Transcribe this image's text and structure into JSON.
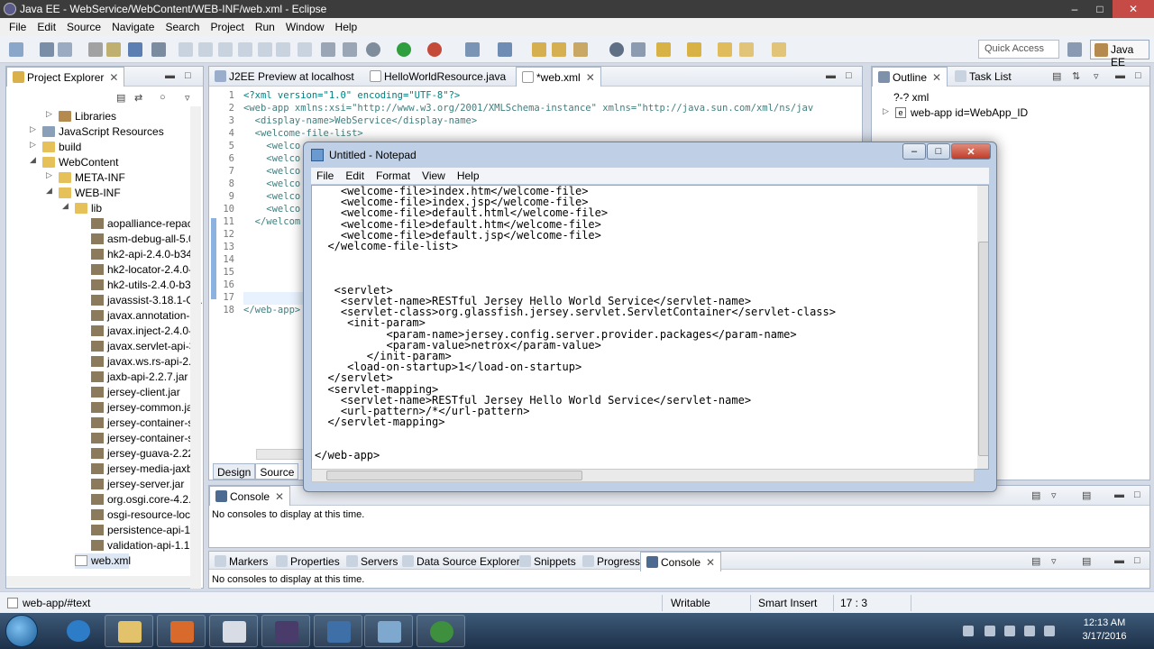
{
  "window": {
    "title": "Java EE - WebService/WebContent/WEB-INF/web.xml - Eclipse"
  },
  "menubar": [
    "File",
    "Edit",
    "Source",
    "Navigate",
    "Search",
    "Project",
    "Run",
    "Window",
    "Help"
  ],
  "toolbar": {
    "quick_access": "Quick Access",
    "perspective": "Java EE"
  },
  "explorer": {
    "title": "Project Explorer",
    "items": [
      "Libraries",
      "JavaScript Resources",
      "build",
      "WebContent",
      "META-INF",
      "WEB-INF",
      "lib",
      "aopalliance-repac",
      "asm-debug-all-5.0",
      "hk2-api-2.4.0-b34.",
      "hk2-locator-2.4.0-",
      "hk2-utils-2.4.0-b34",
      "javassist-3.18.1-GA",
      "javax.annotation-a",
      "javax.inject-2.4.0-",
      "javax.servlet-api-3",
      "javax.ws.rs-api-2.0",
      "jaxb-api-2.2.7.jar",
      "jersey-client.jar",
      "jersey-common.ja",
      "jersey-container-s",
      "jersey-container-s",
      "jersey-guava-2.22.",
      "jersey-media-jaxb",
      "jersey-server.jar",
      "org.osgi.core-4.2.0",
      "osgi-resource-loca",
      "persistence-api-1.0",
      "validation-api-1.1.",
      "web.xml"
    ]
  },
  "editor": {
    "tabs": [
      "J2EE Preview at localhost",
      "HelloWorldResource.java",
      "*web.xml"
    ],
    "lines": [
      {
        "n": "1",
        "text": "<?xml version=\"1.0\" encoding=\"UTF-8\"?>"
      },
      {
        "n": "2",
        "text": "<web-app xmlns:xsi=\"http://www.w3.org/2001/XMLSchema-instance\" xmlns=\"http://java.sun.com/xml/ns/jav"
      },
      {
        "n": "3",
        "text": "  <display-name>WebService</display-name>"
      },
      {
        "n": "4",
        "text": "  <welcome-file-list>"
      },
      {
        "n": "5",
        "text": "    <welco"
      },
      {
        "n": "6",
        "text": "    <welco"
      },
      {
        "n": "7",
        "text": "    <welco"
      },
      {
        "n": "8",
        "text": "    <welco"
      },
      {
        "n": "9",
        "text": "    <welco"
      },
      {
        "n": "10",
        "text": "    <welco"
      },
      {
        "n": "11",
        "text": "  </welcom"
      },
      {
        "n": "12",
        "text": ""
      },
      {
        "n": "13",
        "text": ""
      },
      {
        "n": "14",
        "text": ""
      },
      {
        "n": "15",
        "text": ""
      },
      {
        "n": "16",
        "text": ""
      },
      {
        "n": "17",
        "text": ""
      },
      {
        "n": "18",
        "text": "</web-app>"
      }
    ],
    "bottom_tabs": [
      "Design",
      "Source"
    ]
  },
  "outline": {
    "tabs": [
      "Outline",
      "Task List"
    ],
    "items": [
      "?-? xml",
      "web-app id=WebApp_ID"
    ]
  },
  "console_top": {
    "tab": "Console",
    "message": "No consoles to display at this time."
  },
  "console_bottom": {
    "tabs": [
      "Markers",
      "Properties",
      "Servers",
      "Data Source Explorer",
      "Snippets",
      "Progress",
      "Console"
    ],
    "message": "No consoles to display at this time."
  },
  "statusbar": {
    "path": "web-app/#text",
    "writable": "Writable",
    "insert_mode": "Smart Insert",
    "position": "17 : 3"
  },
  "notepad": {
    "title": "Untitled - Notepad",
    "menu": [
      "File",
      "Edit",
      "Format",
      "View",
      "Help"
    ],
    "content": "    <welcome-file>index.htm</welcome-file>\n    <welcome-file>index.jsp</welcome-file>\n    <welcome-file>default.html</welcome-file>\n    <welcome-file>default.htm</welcome-file>\n    <welcome-file>default.jsp</welcome-file>\n  </welcome-file-list>\n\n\n\n   <servlet>\n    <servlet-name>RESTful Jersey Hello World Service</servlet-name>\n    <servlet-class>org.glassfish.jersey.servlet.ServletContainer</servlet-class>\n     <init-param>\n           <param-name>jersey.config.server.provider.packages</param-name>\n           <param-value>netrox</param-value>\n        </init-param>\n     <load-on-startup>1</load-on-startup>\n  </servlet>\n  <servlet-mapping>\n    <servlet-name>RESTful Jersey Hello World Service</servlet-name>\n    <url-pattern>/*</url-pattern>\n  </servlet-mapping>\n\n\n</web-app>"
  },
  "taskbar": {
    "time": "12:13 AM",
    "date": "3/17/2016"
  }
}
